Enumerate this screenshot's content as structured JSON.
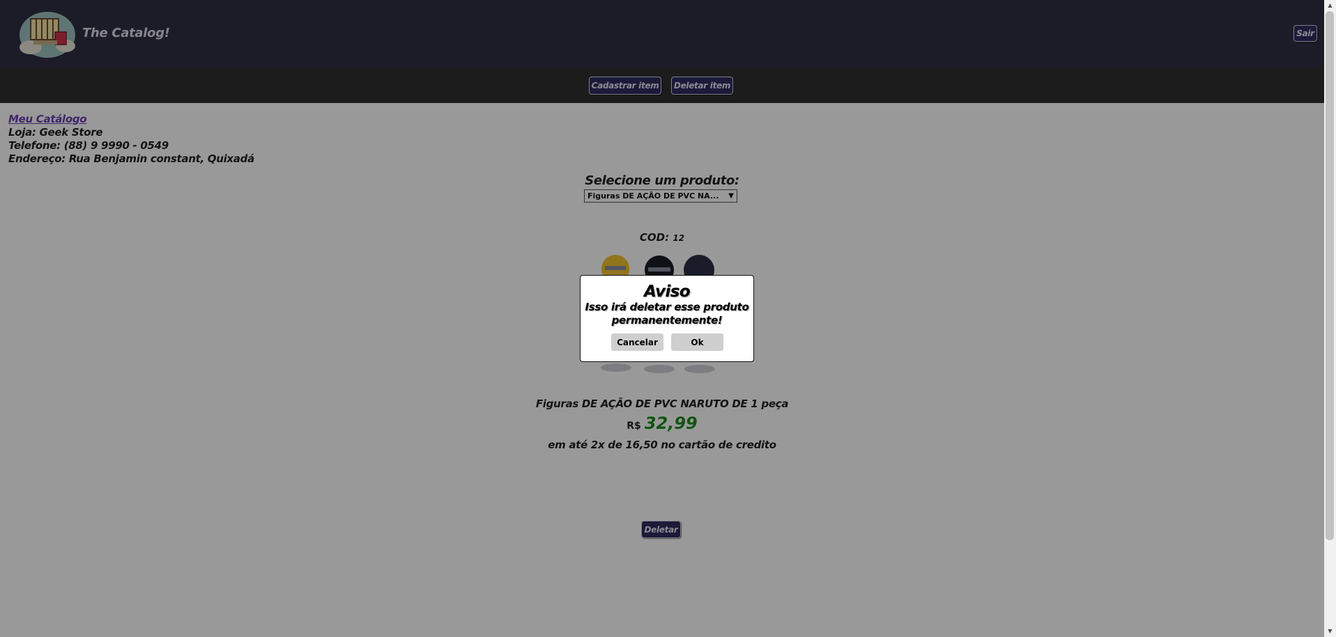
{
  "header": {
    "brand": "The Catalog!",
    "logout_label": "Sair"
  },
  "toolbar": {
    "register_label": "Cadastrar item",
    "delete_item_label": "Deletar item"
  },
  "store": {
    "catalog_link": "Meu Catálogo",
    "store_line": "Loja: Geek Store",
    "phone_line": "Telefone: (88) 9 9990 - 0549",
    "address_line": "Endereço: Rua Benjamin constant, Quixadá"
  },
  "product_select": {
    "title": "Selecione um produto:",
    "selected": "Figuras DE AÇÃO DE PVC NA..."
  },
  "product": {
    "cod_label": "COD:",
    "cod_value": "12",
    "name": "Figuras DE AÇÃO DE PVC NARUTO DE 1 peça",
    "currency": "R$",
    "price": "32,99",
    "installments": "em até 2x de 16,50 no cartão de credito",
    "delete_label": "Deletar"
  },
  "modal": {
    "title": "Aviso",
    "message": "Isso irá deletar esse produto permanentemente!",
    "cancel_label": "Cancelar",
    "ok_label": "Ok"
  },
  "colors": {
    "header_bg": "#302e43",
    "toolbar_bg": "#2f2f2f",
    "button_bg": "#2f2c5e",
    "price": "#1e8c1e",
    "link": "#6a3fb0"
  },
  "icons": {
    "logo": "catalog-cloud-logo",
    "product": "naruto-figures-image"
  }
}
